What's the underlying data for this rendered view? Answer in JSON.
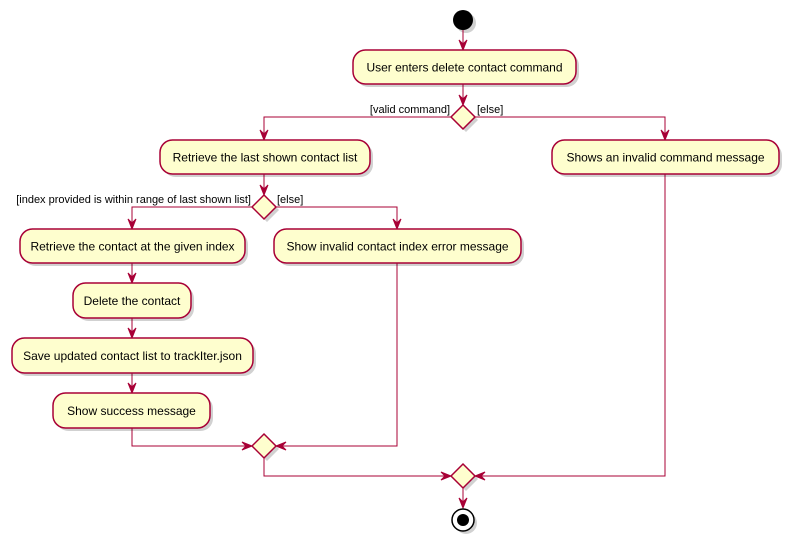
{
  "diagram": {
    "type": "activity",
    "colors": {
      "activity_fill": "#FEFECE",
      "border": "#A80036",
      "start_fill": "#000000"
    },
    "activities": [
      {
        "id": "a1",
        "label": "User enters delete contact command"
      },
      {
        "id": "a2",
        "label": "Retrieve the last shown contact list"
      },
      {
        "id": "a3",
        "label": "Retrieve the contact at the given index"
      },
      {
        "id": "a4",
        "label": "Show invalid contact index error message"
      },
      {
        "id": "a5",
        "label": "Delete the contact"
      },
      {
        "id": "a6",
        "label": "Save updated contact list to trackIter.json"
      },
      {
        "id": "a7",
        "label": "Show success message"
      },
      {
        "id": "a8",
        "label": "Shows an invalid command message"
      }
    ],
    "decisions": [
      {
        "id": "d1",
        "guard_true": "[valid command]",
        "guard_false": "[else]"
      },
      {
        "id": "d2",
        "guard_true": "[index provided is within range of last shown list]",
        "guard_false": "[else]"
      }
    ],
    "edges": [
      {
        "from": "start",
        "to": "a1"
      },
      {
        "from": "a1",
        "to": "d1"
      },
      {
        "from": "d1",
        "to": "a2",
        "guard": "[valid command]"
      },
      {
        "from": "d1",
        "to": "a8",
        "guard": "[else]"
      },
      {
        "from": "a2",
        "to": "d2"
      },
      {
        "from": "d2",
        "to": "a3",
        "guard": "[index provided is within range of last shown list]"
      },
      {
        "from": "d2",
        "to": "a4",
        "guard": "[else]"
      },
      {
        "from": "a3",
        "to": "a5"
      },
      {
        "from": "a5",
        "to": "a6"
      },
      {
        "from": "a6",
        "to": "a7"
      },
      {
        "from": "a7",
        "to": "m1"
      },
      {
        "from": "a4",
        "to": "m1"
      },
      {
        "from": "m1",
        "to": "m2"
      },
      {
        "from": "a8",
        "to": "m2"
      },
      {
        "from": "m2",
        "to": "end"
      }
    ]
  }
}
